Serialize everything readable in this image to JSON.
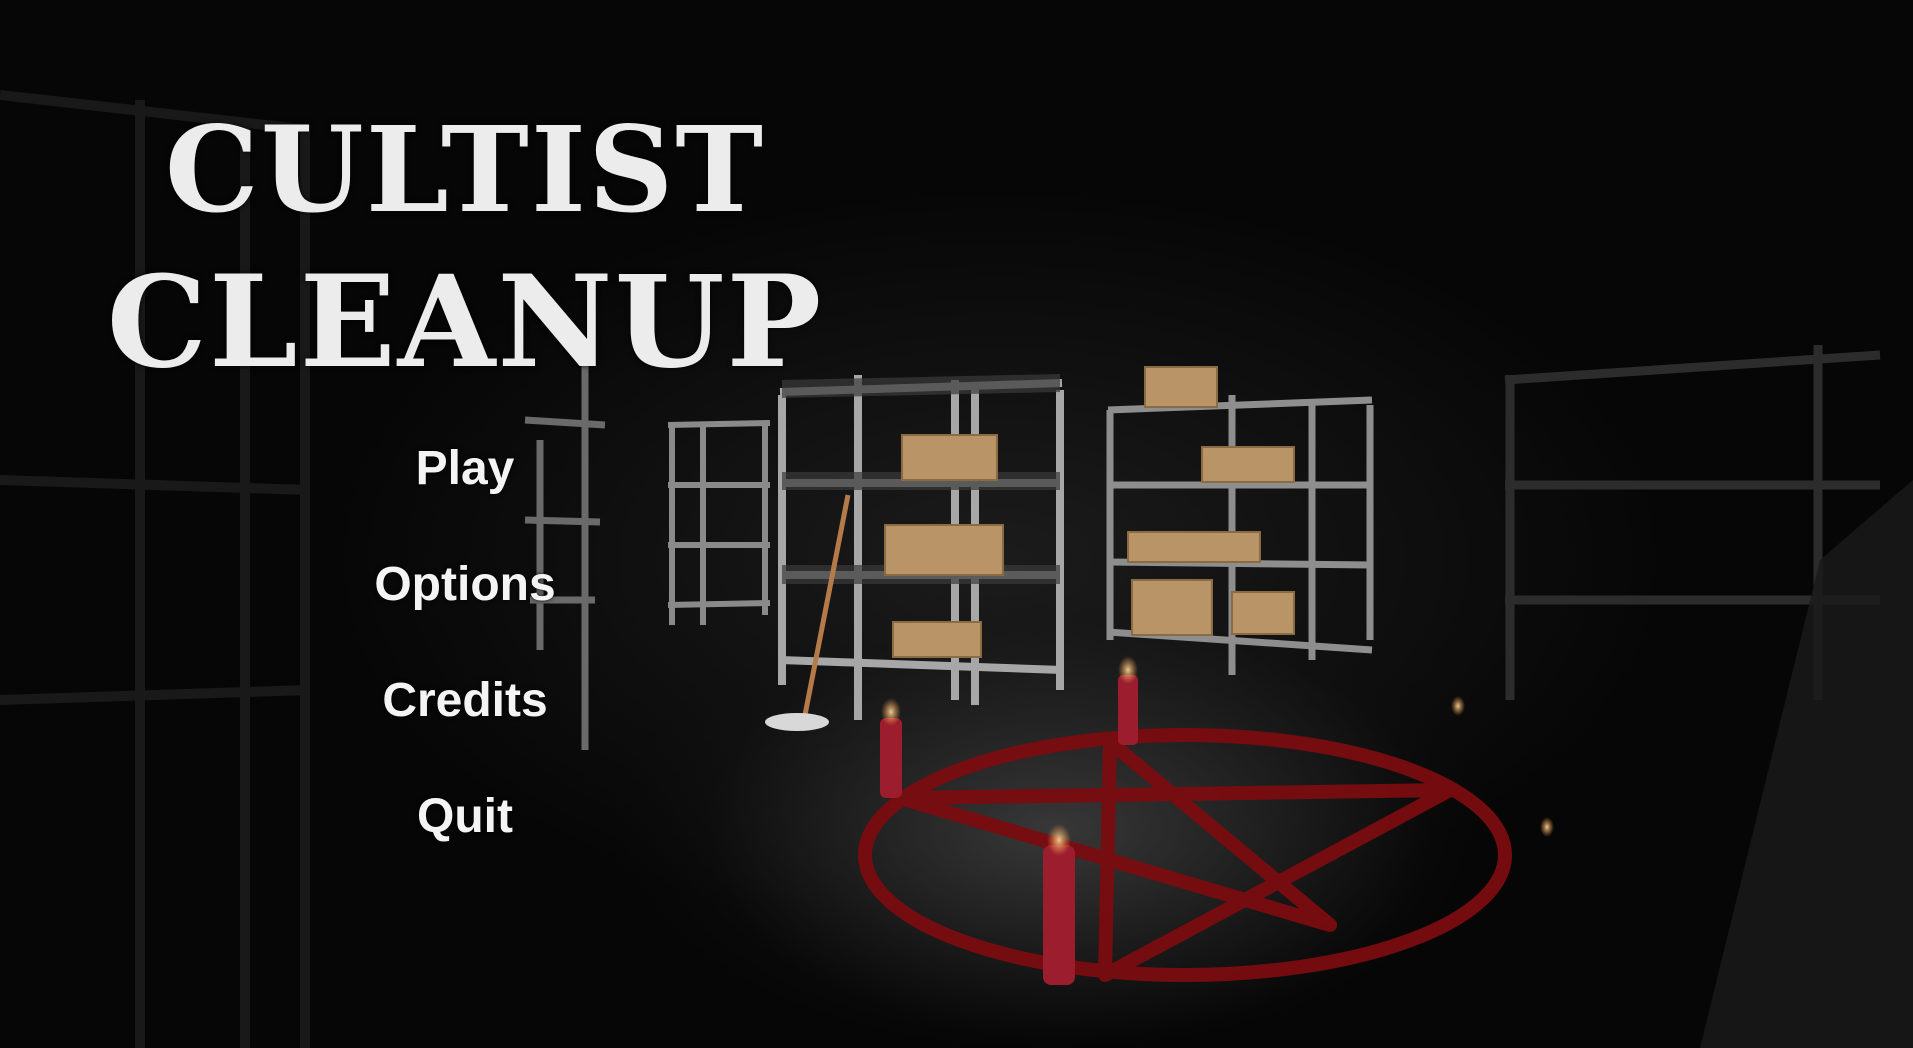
{
  "title": {
    "line1": "CULTIST",
    "line2": "CLEANUP"
  },
  "menu": {
    "items": [
      {
        "id": "play",
        "label": "Play"
      },
      {
        "id": "options",
        "label": "Options"
      },
      {
        "id": "credits",
        "label": "Credits"
      },
      {
        "id": "quit",
        "label": "Quit"
      }
    ]
  },
  "colors": {
    "title": "#ececec",
    "menu_text": "#f4f4f4",
    "pentagram": "#7a0c10",
    "candle": "#9c1e2e",
    "flame": "#ffd27a",
    "shelf": "#8c8c8c",
    "box": "#b89466",
    "background": "#050505"
  }
}
